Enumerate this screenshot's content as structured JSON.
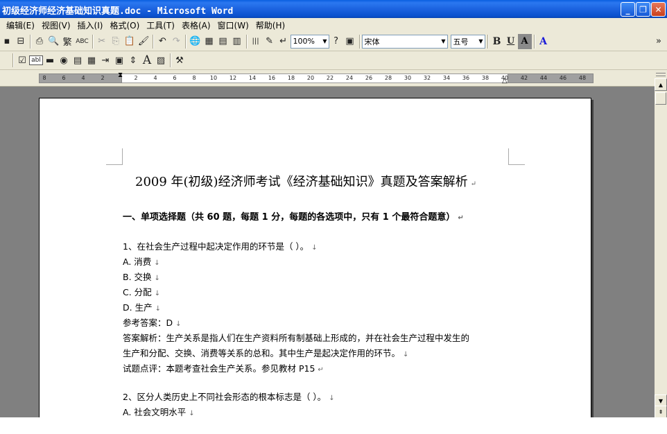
{
  "window": {
    "title": "初级经济师经济基础知识真题.doc - Microsoft Word",
    "minimize": "_",
    "maximize": "❐",
    "close": "✕"
  },
  "menu": [
    "编辑(E)",
    "视图(V)",
    "插入(I)",
    "格式(O)",
    "工具(T)",
    "表格(A)",
    "窗口(W)",
    "帮助(H)"
  ],
  "toolbar": {
    "save": "▪",
    "permission": "⊟",
    "print": "⎙",
    "preview": "🔍",
    "traditional": "繁",
    "spell": "ABC",
    "cut": "✂",
    "copy": "⎘",
    "paste": "📋",
    "format_painter": "🖌",
    "undo": "↶",
    "redo": "↷",
    "hyperlink": "🌐",
    "tables": "▦",
    "insert_table": "▤",
    "excel": "▥",
    "columns": "|||",
    "drawing": "✎",
    "show_hide": "↵",
    "zoom": "100%",
    "help": "?",
    "read": "▣",
    "font": "宋体",
    "size": "五号",
    "bold": "B",
    "underline": "U",
    "char_shading": "A",
    "font_color": "A",
    "overflow": "»"
  },
  "forms_toolbar": {
    "checkbox": "☑",
    "textfield": "abl",
    "line": "▬",
    "radio": "◉",
    "list": "▤",
    "frame": "▦",
    "tab": "⇥",
    "grid": "▣",
    "spacing": "⇕",
    "text": "A",
    "image": "▨",
    "tools": "⚒"
  },
  "ruler": {
    "ticks": [
      "8",
      "6",
      "4",
      "2",
      "2",
      "4",
      "6",
      "8",
      "10",
      "12",
      "14",
      "16",
      "18",
      "20",
      "22",
      "24",
      "26",
      "28",
      "30",
      "32",
      "34",
      "36",
      "38",
      "40",
      "42",
      "44",
      "46",
      "48"
    ]
  },
  "document": {
    "title": "2009 年(初级)经济师考试《经济基础知识》真题及答案解析",
    "section": "一、单项选择题（共 60 题，每题 1 分，每题的各选项中，只有 1 个最符合题意）",
    "lines": [
      "1、在社会生产过程中起决定作用的环节是（   ）。",
      "A.  消费",
      "B.  交换",
      "C.  分配",
      "D.  生产",
      "参考答案：D",
      "答案解析：生产关系是指人们在生产资料所有制基础上形成的，并在社会生产过程中发生的",
      "生产和分配、交换、消费等关系的总和。其中生产是起决定作用的环节。",
      "试题点评：本题考查社会生产关系。参见教材 P15",
      "",
      "2、区分人类历史上不同社会形态的根本标志是（   ）。",
      "A.  社会文明水平"
    ],
    "paragraph_mark": "↵",
    "line_break": "↓"
  }
}
